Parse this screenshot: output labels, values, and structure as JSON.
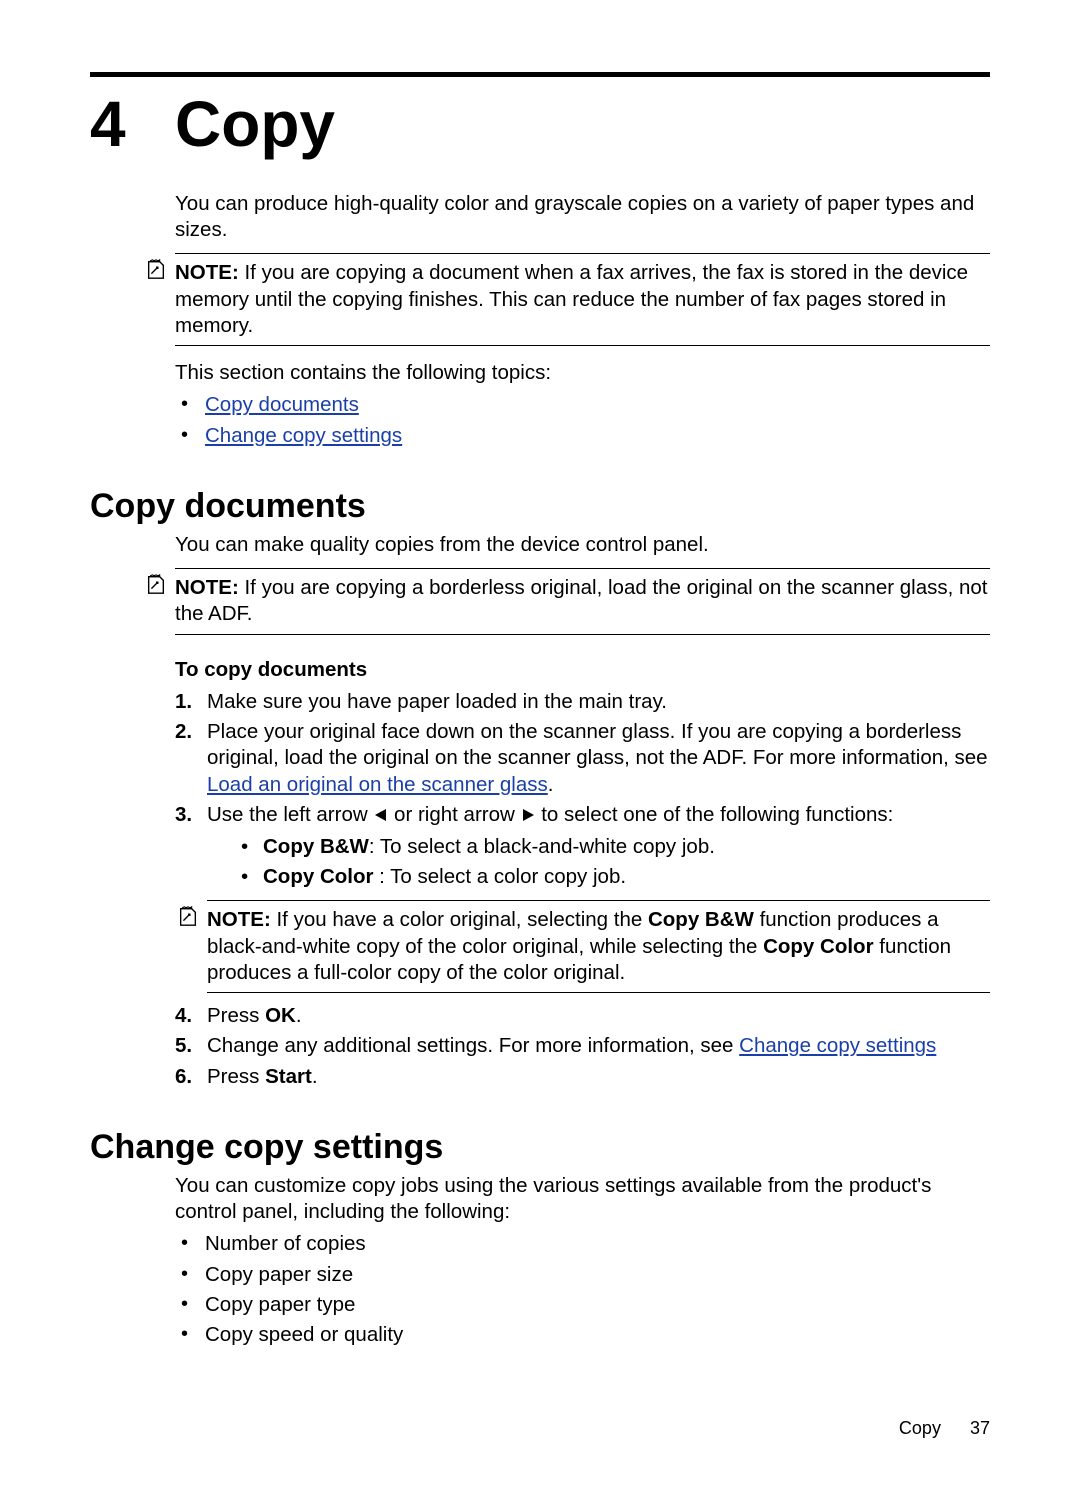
{
  "chapter": {
    "number": "4",
    "title": "Copy"
  },
  "intro": "You can produce high-quality color and grayscale copies on a variety of paper types and sizes.",
  "note1": {
    "label": "NOTE:",
    "text": "If you are copying a document when a fax arrives, the fax is stored in the device memory until the copying finishes. This can reduce the number of fax pages stored in memory."
  },
  "toc_lead": "This section contains the following topics:",
  "toc": {
    "item1": "Copy documents",
    "item2": "Change copy settings"
  },
  "sec1": {
    "heading": "Copy documents",
    "intro": "You can make quality copies from the device control panel.",
    "note": {
      "label": "NOTE:",
      "text": "If you are copying a borderless original, load the original on the scanner glass, not the ADF."
    },
    "subhead": "To copy documents",
    "step1": "Make sure you have paper loaded in the main tray.",
    "step2a": "Place your original face down on the scanner glass. If you are copying a borderless original, load the original on the scanner glass, not the ADF. For more information, see ",
    "step2_link": "Load an original on the scanner glass",
    "step2b": ".",
    "step3a": "Use the left arrow ",
    "step3b": " or right arrow ",
    "step3c": " to select one of the following functions:",
    "opt_bw_label": "Copy B&W",
    "opt_bw_text": ": To select a black-and-white copy job.",
    "opt_color_label": "Copy Color",
    "opt_color_text": " : To select a color copy job.",
    "inner_note": {
      "label": "NOTE:",
      "a": "If you have a color original, selecting the ",
      "bw": "Copy B&W",
      "b": " function produces a black-and-white copy of the color original, while selecting the ",
      "color": "Copy Color",
      "c": " function produces a full-color copy of the color original."
    },
    "step4a": "Press ",
    "step4_ok": "OK",
    "step4b": ".",
    "step5a": "Change any additional settings. For more information, see ",
    "step5_link": "Change copy settings",
    "step6a": "Press ",
    "step6_start": "Start",
    "step6b": "."
  },
  "sec2": {
    "heading": "Change copy settings",
    "intro": "You can customize copy jobs using the various settings available from the product's control panel, including the following:",
    "b1": "Number of copies",
    "b2": "Copy paper size",
    "b3": "Copy paper type",
    "b4": "Copy speed or quality"
  },
  "footer": {
    "label": "Copy",
    "page": "37"
  }
}
